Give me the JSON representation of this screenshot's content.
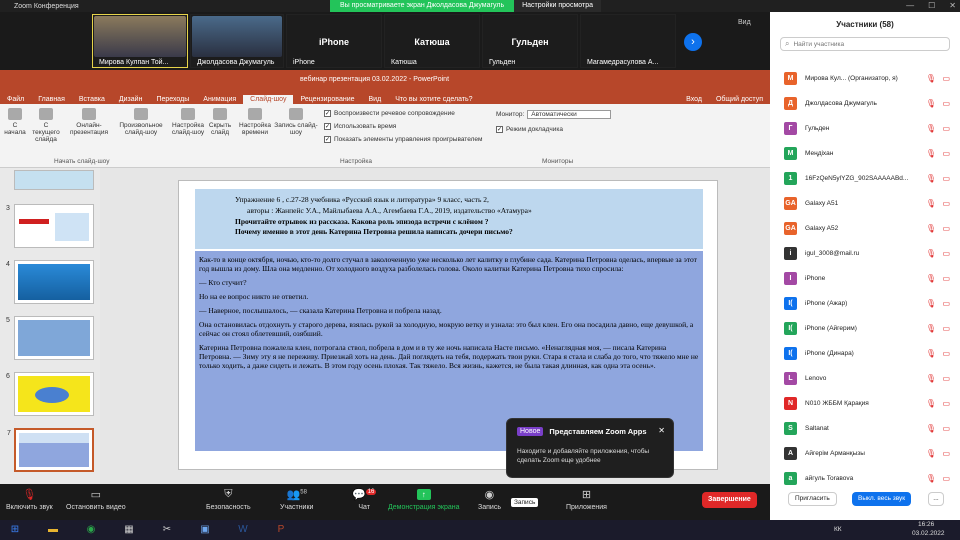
{
  "titlebar": {
    "title": "Zoom Конференция",
    "banner": "Вы просматриваете экран Джолдасова Джумагуль",
    "view_settings": "Настройки просмотра",
    "controls": [
      "—",
      "☐",
      "✕"
    ]
  },
  "gallery": {
    "tiles": [
      {
        "name": "Мирова Кулпан Той...",
        "type": "video"
      },
      {
        "name": "Джолдасова Джумагуль",
        "type": "video"
      },
      {
        "name": "iPhone",
        "big": "iPhone"
      },
      {
        "name": "Катюша",
        "big": "Катюша"
      },
      {
        "name": "Гульден",
        "big": "Гульден"
      },
      {
        "name": "Магамедрасулова А..."
      }
    ],
    "view_label": "Вид"
  },
  "ppt": {
    "title": "вебинар презентация 03.02.2022 - PowerPoint",
    "tabs": [
      "Файл",
      "Главная",
      "Вставка",
      "Дизайн",
      "Переходы",
      "Анимация",
      "Слайд-шоу",
      "Рецензирование",
      "Вид",
      "Что вы хотите сделать?"
    ],
    "active_tab": "Слайд-шоу",
    "right": [
      "Вход",
      "Общий доступ"
    ],
    "ribbon": {
      "btn1": "С начала",
      "btn2": "С текущего слайда",
      "btn3": "Онлайн-презентация",
      "btn4": "Произвольное слайд-шоу",
      "btn5": "Настройка слайд-шоу",
      "btn6": "Скрыть слайд",
      "btn7": "Настройка времени",
      "btn8": "Запись слайд-шоу",
      "chk1": "Воспроизвести речевое сопровождение",
      "chk2": "Использовать время",
      "chk3": "Показать элементы управления проигрывателем",
      "monitor_label": "Монитор:",
      "monitor_value": "Автоматически",
      "presenter": "Режим докладчика",
      "grp1": "Начать слайд-шоу",
      "grp2": "Настройка",
      "grp3": "Мониторы"
    },
    "thumb_numbers": [
      "3",
      "4",
      "5",
      "6",
      "7"
    ],
    "slide": {
      "head1": "Упражнение 6 ,     с.27-28 учебника «Русский язык и литература»     9 класс,   часть 2,",
      "head2": "авторы : Жанпейс У.А., Майлыбаева А.А., Агембаева Г.А., 2019, издательство «Атамура»",
      "head3": "Прочитайте отрывок из рассказа. Какова роль эпизода встречи с клёном ?",
      "head4": "Почему именно в этот день Катерина Петровна решила написать дочери письмо?",
      "p1": "Как-то в конце октября, ночью, кто-то долго стучал в заколоченную уже несколько лет калитку в глубине сада. Катерина Петровна оделась, впервые за этот год вышла из дому. Шла она медленно. От холодного воздуха разболелась голова. Около калитки Катерина Петровна тихо спросила:",
      "p2": "— Кто стучит?",
      "p3": "Но на ее вопрос никто не ответил.",
      "p4": "— Наверное, послышалось, — сказала Катерина Петровна и побрела назад.",
      "p5": "Она остановилась отдохнуть у старого дерева, взялась рукой за холодную, мокрую ветку и узнала: это был клен. Его она посадила давно, еще девушкой, а сейчас он стоял облетевший, озябший.",
      "p6": "Катерина Петровна пожалела клен, потрогала ствол, побрела в дом и в ту же ночь написала Насте письмо. «Ненаглядная моя, — писала Катерина Петровна. — Зиму эту я не переживу. Приезжай хоть на день. Дай поглядеть на тебя, подержать твои руки. Стара я стала и слаба до того, что тяжело мне не только ходить, а даже сидеть и лежать. В этом году осень плохая. Так тяжело. Вся жизнь, кажется, не была такая длинная, как одна эта осень»."
    }
  },
  "toast": {
    "badge": "Новое",
    "title": "Представляем Zoom Apps",
    "body": "Находите и добавляйте приложения, чтобы сделать Zoom еще удобнее"
  },
  "participants": {
    "title": "Участники (58)",
    "search_placeholder": "Найти участника",
    "list": [
      {
        "letter": "М",
        "color": "#e8632b",
        "name": "Мирова Кул... (Организатор, я)"
      },
      {
        "letter": "Д",
        "color": "#e8632b",
        "name": "Джолдасова Джумагуль"
      },
      {
        "letter": "Г",
        "color": "#a349a4",
        "name": "Гульден"
      },
      {
        "letter": "М",
        "color": "#23a55a",
        "name": "Меңдіхан"
      },
      {
        "letter": "1",
        "color": "#23a55a",
        "name": "16FzQeN5ylYZG_902SAAAAABd..."
      },
      {
        "letter": "GA",
        "color": "#e8632b",
        "name": "Galaxy A51"
      },
      {
        "letter": "GA",
        "color": "#e8632b",
        "name": "Galaxy A52"
      },
      {
        "letter": "i",
        "color": "#333",
        "name": "igul_3008@mail.ru"
      },
      {
        "letter": "I",
        "color": "#a349a4",
        "name": "iPhone"
      },
      {
        "letter": "I(",
        "color": "#0e72ed",
        "name": "iPhone (Ажар)"
      },
      {
        "letter": "I(",
        "color": "#23a55a",
        "name": "iPhone (Айгерим)"
      },
      {
        "letter": "I(",
        "color": "#0e72ed",
        "name": "iPhone (Динара)"
      },
      {
        "letter": "L",
        "color": "#a349a4",
        "name": "Lenovo"
      },
      {
        "letter": "N",
        "color": "#e02828",
        "name": "N010 ЖББМ Қарақия"
      },
      {
        "letter": "S",
        "color": "#23a55a",
        "name": "Saltanat"
      },
      {
        "letter": "А",
        "color": "#333",
        "name": "Айгерім Арманқызы"
      },
      {
        "letter": "а",
        "color": "#23a55a",
        "name": "айгуль Toraвova"
      }
    ],
    "invite": "Пригласить",
    "mute_all": "Выкл. весь звук",
    "more": "..."
  },
  "toolbar": {
    "mute": "Включить звук",
    "video": "Остановить видео",
    "security": "Безопасность",
    "participants": "Участники",
    "participants_count": "58",
    "chat": "Чат",
    "chat_badge": "16",
    "share": "Демонстрация экрана",
    "record": "Запись",
    "apps": "Приложения",
    "tooltip": "Запись",
    "end": "Завершение"
  },
  "taskbar": {
    "lang": "КК",
    "time": "16:26",
    "date": "03.02.2022"
  }
}
